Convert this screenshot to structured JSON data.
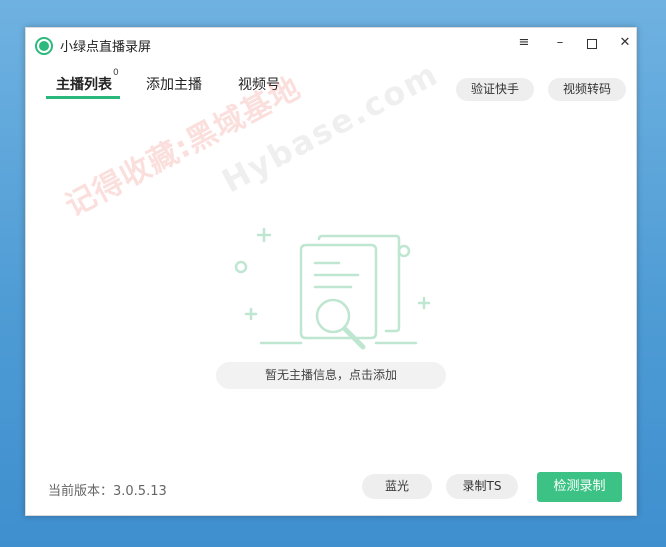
{
  "window": {
    "title": "小绿点直播录屏"
  },
  "window_controls": {
    "menu": "≡",
    "minimize": "–",
    "close": "✕"
  },
  "tabs": [
    {
      "label": "主播列表",
      "badge": "0"
    },
    {
      "label": "添加主播"
    },
    {
      "label": "视频号"
    }
  ],
  "header_actions": {
    "verify": "验证快手",
    "transcode": "视频转码"
  },
  "watermark": {
    "line1": "记得收藏:黑域基地",
    "line2": "Hybase.com"
  },
  "empty_state": {
    "message": "暂无主播信息，点击添加"
  },
  "footer": {
    "version": "当前版本：3.0.5.13",
    "bluray": "蓝光",
    "record_ts": "录制TS",
    "detect_record": "检测录制"
  },
  "colors": {
    "accent": "#3cc285",
    "tab_underline": "#2ab77c",
    "illustration": "#bfe6d1"
  },
  "icons": {
    "empty": "document-search-icon"
  }
}
